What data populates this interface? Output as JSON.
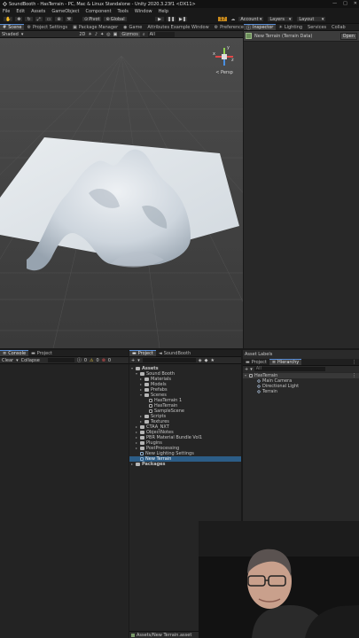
{
  "window": {
    "title": "SoundBooth - HasTerrain - PC, Mac & Linux Standalone - Unity 2020.3.23f1 <DX11>",
    "controls": [
      "—",
      "□",
      "✕"
    ]
  },
  "menu": [
    "File",
    "Edit",
    "Assets",
    "GameObject",
    "Component",
    "Tools",
    "Window",
    "Help"
  ],
  "toolbar": {
    "pivot": "Pivot",
    "global": "Global",
    "account": "Account",
    "layers": "Layers",
    "layout": "Layout",
    "badge": "17"
  },
  "top_tabs": [
    {
      "label": "Scene",
      "icon": "#"
    },
    {
      "label": "Project Settings",
      "icon": "⚙"
    },
    {
      "label": "Package Manager",
      "icon": "▣"
    },
    {
      "label": "Game",
      "icon": "◉"
    },
    {
      "label": "Attributes Example Window",
      "icon": ""
    },
    {
      "label": "Preferences",
      "icon": "⚙"
    }
  ],
  "scene_bar": {
    "shading": "Shaded",
    "mode": "2D",
    "gizmos": "Gizmos",
    "search": "All"
  },
  "gizmo": {
    "y": "y",
    "x": "x",
    "z": "z",
    "view": "< Persp"
  },
  "inspector": {
    "tabs": [
      "Inspector",
      "Lighting",
      "Services",
      "Collab"
    ],
    "object": "New Terrain (Terrain Data)",
    "open": "Open"
  },
  "asset_labels": "Asset Labels",
  "console": {
    "tabs": [
      "Console",
      "Project"
    ],
    "clear": "Clear",
    "collapse": "Collapse",
    "counts": [
      "0",
      "0",
      "0"
    ]
  },
  "project": {
    "tabs": [
      "Project",
      "SoundBooth"
    ],
    "items": [
      {
        "label": "Assets",
        "depth": 0,
        "type": "folder",
        "bold": true
      },
      {
        "label": "Sound Booth",
        "depth": 1,
        "type": "folder"
      },
      {
        "label": "Materials",
        "depth": 2,
        "type": "folder"
      },
      {
        "label": "Models",
        "depth": 2,
        "type": "folder"
      },
      {
        "label": "Prefabs",
        "depth": 2,
        "type": "folder"
      },
      {
        "label": "Scenes",
        "depth": 2,
        "type": "folder"
      },
      {
        "label": "HasTerrain 1",
        "depth": 3,
        "type": "scene"
      },
      {
        "label": "HasTerrain",
        "depth": 3,
        "type": "scene"
      },
      {
        "label": "SampleScene",
        "depth": 3,
        "type": "scene"
      },
      {
        "label": "Scripts",
        "depth": 2,
        "type": "folder"
      },
      {
        "label": "Textures",
        "depth": 2,
        "type": "folder"
      },
      {
        "label": "CTAA_NXT",
        "depth": 1,
        "type": "folder"
      },
      {
        "label": "ObjectNotes",
        "depth": 1,
        "type": "folder"
      },
      {
        "label": "PBR Material Bundle Vol1",
        "depth": 1,
        "type": "folder"
      },
      {
        "label": "Plugins",
        "depth": 1,
        "type": "folder"
      },
      {
        "label": "PostProcessing",
        "depth": 1,
        "type": "folder"
      },
      {
        "label": "New Lighting Settings",
        "depth": 1,
        "type": "asset"
      },
      {
        "label": "New Terrain",
        "depth": 1,
        "type": "asset",
        "selected": true
      },
      {
        "label": "Packages",
        "depth": 0,
        "type": "folder",
        "bold": true
      }
    ],
    "footer": "Assets/New Terrain.asset"
  },
  "hierarchy": {
    "tabs": [
      "Project",
      "Hierarchy"
    ],
    "search": "All",
    "scene": "HasTerrain",
    "items": [
      "Main Camera",
      "Directional Light",
      "Terrain"
    ]
  },
  "colors": {
    "accent": "#2c5d87",
    "tab_highlight": "#5a8fd8",
    "scene_bg": "#4a4a4a"
  }
}
